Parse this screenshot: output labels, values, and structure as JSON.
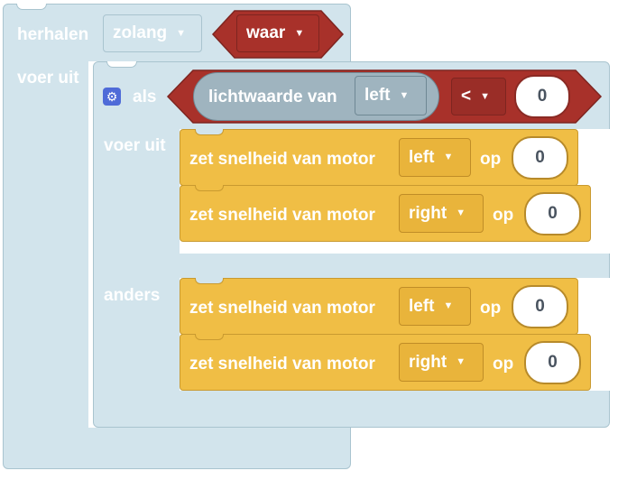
{
  "loop": {
    "keyword": "herhalen",
    "mode_dropdown": "zolang",
    "condition_dropdown": "waar",
    "do_label": "voer uit"
  },
  "if_block": {
    "keyword": "als",
    "sensor_label": "lichtwaarde van",
    "sensor_port": "left",
    "operator": "<",
    "compare_value": "0",
    "then_label": "voer uit",
    "else_label": "anders"
  },
  "then_statements": [
    {
      "text": "zet snelheid van motor",
      "motor": "left",
      "op": "op",
      "value": "0"
    },
    {
      "text": "zet snelheid van motor",
      "motor": "right",
      "op": "op",
      "value": "0"
    }
  ],
  "else_statements": [
    {
      "text": "zet snelheid van motor",
      "motor": "left",
      "op": "op",
      "value": "0"
    },
    {
      "text": "zet snelheid van motor",
      "motor": "right",
      "op": "op",
      "value": "0"
    }
  ],
  "colors": {
    "loop": "#d2e4ec",
    "logic_red": "#a8312a",
    "sensor_slate": "#9fb4bf",
    "motor_yellow": "#f0be45",
    "gear_blue": "#4f6bd8"
  },
  "icons": {
    "dropdown": "triangle-down",
    "mutator": "gear"
  }
}
